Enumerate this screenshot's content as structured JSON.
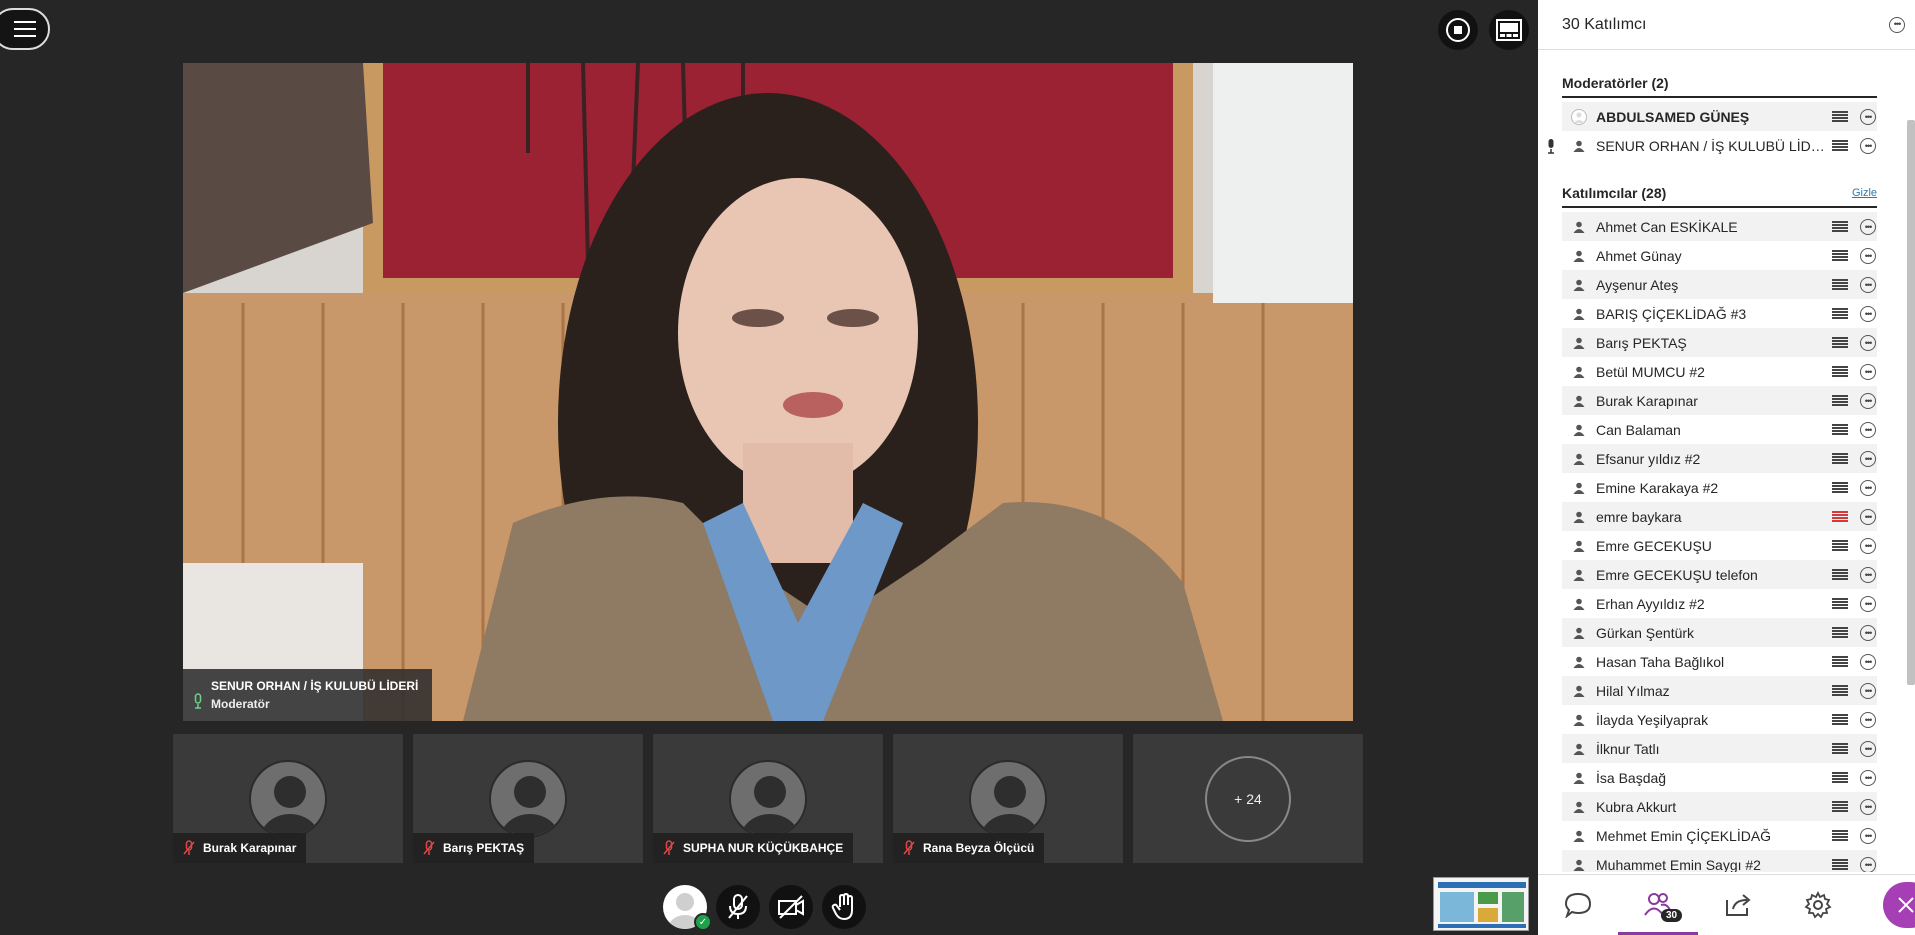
{
  "main_video": {
    "speaker_name": "SENUR ORHAN / İŞ KULUBÜ LİDERİ",
    "speaker_role": "Moderatör"
  },
  "tiles": [
    {
      "name": "Burak Karapınar"
    },
    {
      "name": "Barış PEKTAŞ"
    },
    {
      "name": "SUPHA NUR KÜÇÜKBAHÇE"
    },
    {
      "name": "Rana Beyza Ölçücü"
    }
  ],
  "more_tile": {
    "label": "+ 24"
  },
  "panel": {
    "title": "30 Katılımcı",
    "moderators_header": "Moderatörler (2)",
    "participants_header": "Katılımcılar (28)",
    "hide_label": "Gizle",
    "moderators": [
      {
        "name": "ABDULSAMED GÜNEŞ"
      },
      {
        "name": "SENUR ORHAN / İŞ KULUBÜ LİDERİ"
      }
    ],
    "participants": [
      {
        "name": "Ahmet Can ESKİKALE"
      },
      {
        "name": "Ahmet Günay"
      },
      {
        "name": "Ayşenur Ateş"
      },
      {
        "name": "BARIŞ ÇİÇEKLİDAĞ #3"
      },
      {
        "name": "Barış PEKTAŞ"
      },
      {
        "name": "Betül MUMCU #2"
      },
      {
        "name": "Burak Karapınar"
      },
      {
        "name": "Can Balaman"
      },
      {
        "name": "Efsanur yıldız #2"
      },
      {
        "name": "Emine Karakaya #2"
      },
      {
        "name": "emre baykara"
      },
      {
        "name": "Emre GECEKUŞU"
      },
      {
        "name": "Emre GECEKUŞU telefon"
      },
      {
        "name": "Erhan Ayyıldız #2"
      },
      {
        "name": "Gürkan Şentürk"
      },
      {
        "name": "Hasan Taha Bağlıkol"
      },
      {
        "name": "Hilal Yılmaz"
      },
      {
        "name": "İlayda Yeşilyaprak"
      },
      {
        "name": "İlknur Tatlı"
      },
      {
        "name": "İsa Başdağ"
      },
      {
        "name": "Kubra Akkurt"
      },
      {
        "name": "Mehmet Emin ÇİÇEKLİDAĞ"
      },
      {
        "name": "Muhammet Emin Saygı #2"
      }
    ],
    "tabs": {
      "participants_badge": "30"
    }
  },
  "icons": {
    "menu": "hamburger-menu-icon",
    "record": "stop-record-icon",
    "layout": "layout-icon",
    "mic_muted": "mic-muted-icon",
    "camera_off": "camera-off-icon",
    "hand": "raise-hand-icon",
    "chat": "chat-icon",
    "attendees": "attendees-icon",
    "share": "share-icon",
    "settings": "settings-icon",
    "close": "close-icon"
  },
  "colors": {
    "background": "#262626",
    "panel": "#ffffff",
    "accent_purple": "#a63fb5",
    "status_green": "#1fa14b",
    "muted_red": "#e04848",
    "link_blue": "#2a7ab0"
  }
}
